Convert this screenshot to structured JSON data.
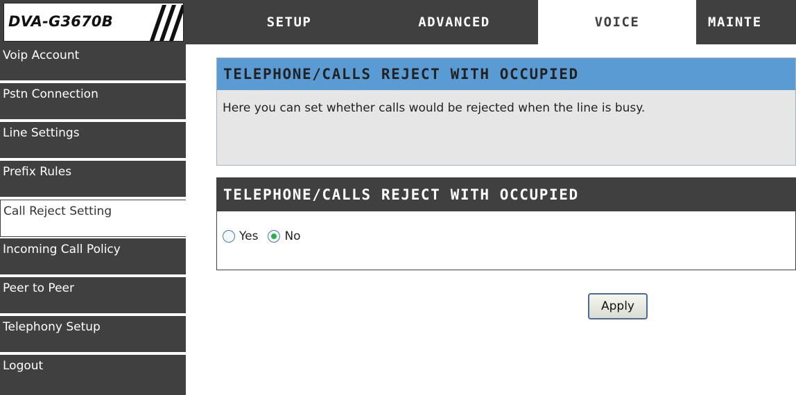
{
  "header": {
    "model": "DVA-G3670B",
    "tabs": [
      {
        "label": "SETUP",
        "active": false
      },
      {
        "label": "ADVANCED",
        "active": false
      },
      {
        "label": "VOICE",
        "active": true
      },
      {
        "label": "MAINTE",
        "active": false
      }
    ]
  },
  "sidebar": {
    "items": [
      {
        "label": "Voip Account"
      },
      {
        "label": "Pstn Connection"
      },
      {
        "label": "Line Settings"
      },
      {
        "label": "Prefix Rules"
      },
      {
        "label": "Call Reject Setting",
        "active": true
      },
      {
        "label": "Incoming Call Policy"
      },
      {
        "label": "Peer to Peer"
      },
      {
        "label": "Telephony Setup"
      },
      {
        "label": "Logout"
      }
    ]
  },
  "info_panel": {
    "title": "TELEPHONE/CALLS REJECT WITH OCCUPIED",
    "description": "Here you can set whether calls would be rejected when the line is busy."
  },
  "settings_panel": {
    "title": "TELEPHONE/CALLS REJECT WITH OCCUPIED",
    "options": [
      {
        "label": "Yes",
        "selected": false
      },
      {
        "label": "No",
        "selected": true
      }
    ]
  },
  "apply_label": "Apply",
  "colors": {
    "dark": "#404040",
    "accent_blue": "#5a9bd4",
    "panel_bg": "#e6e6e6",
    "radio_selected": "#2db04a"
  }
}
